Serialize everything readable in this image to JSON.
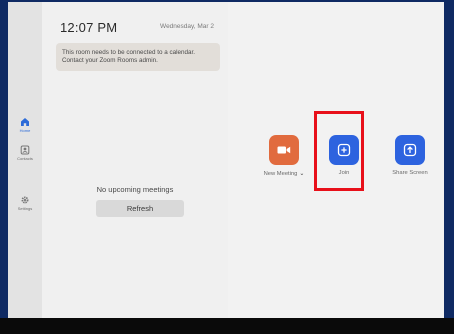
{
  "header": {
    "time": "12:07 PM",
    "date": "Wednesday, Mar 2"
  },
  "notice": {
    "text": "This room needs to be connected to a calendar. Contact your Zoom Rooms admin."
  },
  "nav": {
    "items": [
      {
        "label": "Home",
        "icon": "home-icon",
        "active": true
      },
      {
        "label": "Contacts",
        "icon": "contacts-icon",
        "active": false
      },
      {
        "label": "Settings",
        "icon": "settings-icon",
        "active": false
      }
    ]
  },
  "meetings": {
    "empty_text": "No upcoming meetings",
    "refresh_label": "Refresh"
  },
  "actions": [
    {
      "label": "New Meeting",
      "icon": "camera-icon",
      "color": "#e16b3e"
    },
    {
      "label": "Join",
      "icon": "plus-icon",
      "color": "#2d63df"
    },
    {
      "label": "Share Screen",
      "icon": "upload-arrow-icon",
      "color": "#2d63df"
    }
  ],
  "colors": {
    "accent": "#2d63df",
    "highlight": "#e8101a",
    "new_meeting": "#e16b3e"
  }
}
